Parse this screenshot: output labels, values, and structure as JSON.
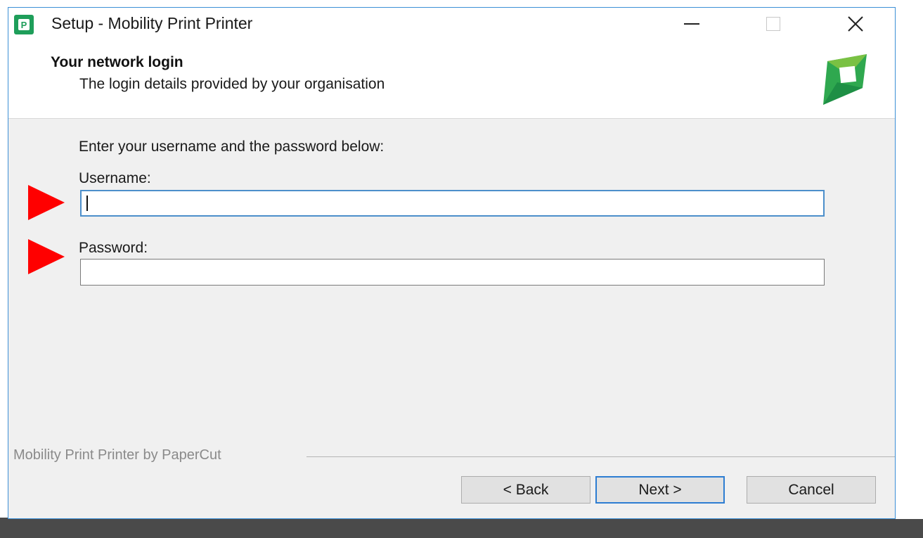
{
  "window": {
    "title": "Setup - Mobility Print Printer",
    "app_icon": "papercut-p-icon"
  },
  "header": {
    "title": "Your network login",
    "subtitle": "The login details provided by your organisation",
    "logo": "papercut-logo"
  },
  "form": {
    "instruction": "Enter your username and the password below:",
    "username_label": "Username:",
    "username_value": "",
    "password_label": "Password:",
    "password_value": ""
  },
  "footer": {
    "brand": "Mobility Print Printer by PaperCut",
    "back_label": "< Back",
    "next_label": "Next >",
    "cancel_label": "Cancel"
  },
  "annotations": {
    "arrow_color": "#ff0000"
  },
  "colors": {
    "brand_green": "#1e9e5a",
    "focus_blue": "#4c8fcb"
  }
}
